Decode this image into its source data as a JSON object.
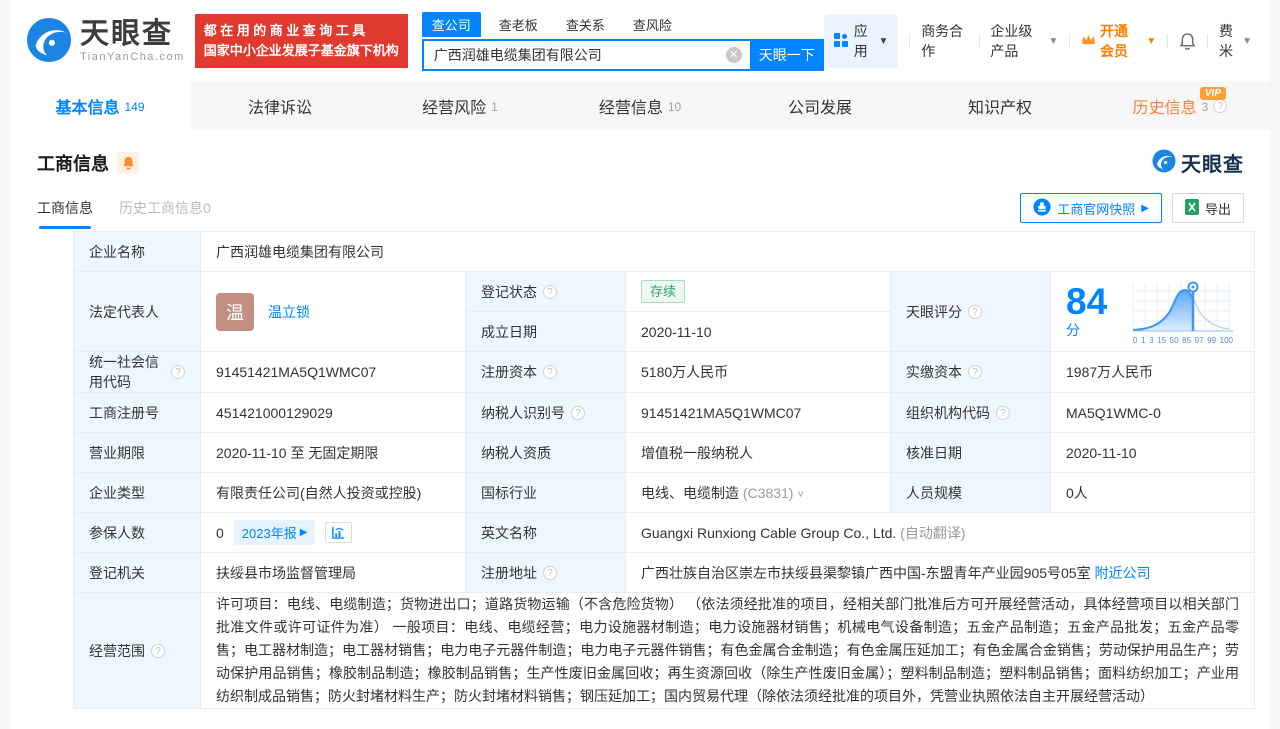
{
  "colors": {
    "primary_blue": "#0084ff",
    "vip_orange": "#ff7d00",
    "promo_red": "#e03a2f",
    "status_green": "#2aa85f",
    "label_cell_blue": "#eef7ff",
    "avatar_brown": "#c28f82"
  },
  "header": {
    "brand": "天眼查",
    "brand_domain": "TianYanCha.com",
    "promo_line1": "都在用的商业查询工具",
    "promo_line2": "国家中小企业发展子基金旗下机构",
    "search_tabs": [
      {
        "label": "查公司"
      },
      {
        "label": "查老板"
      },
      {
        "label": "查关系"
      },
      {
        "label": "查风险"
      }
    ],
    "search_value": "广西润雄电缆集团有限公司",
    "search_button": "天眼一下",
    "nav_apps": "应用",
    "nav_cooperation": "商务合作",
    "nav_enterprise": "企业级产品",
    "nav_vip": "开通会员",
    "nav_user": "费米"
  },
  "tabs": [
    {
      "label": "基本信息",
      "count": "149"
    },
    {
      "label": "法律诉讼",
      "count": ""
    },
    {
      "label": "经营风险",
      "count": "1"
    },
    {
      "label": "经营信息",
      "count": "10"
    },
    {
      "label": "公司发展",
      "count": ""
    },
    {
      "label": "知识产权",
      "count": ""
    },
    {
      "label": "历史信息",
      "count": "3",
      "badge": "VIP"
    }
  ],
  "section": {
    "title": "工商信息",
    "subtab_active": "工商信息",
    "subtab_history": "历史工商信息0",
    "snapshot_button": "工商官网快照",
    "export_button": "导出",
    "watermark": "天眼查"
  },
  "table": {
    "company_name_label": "企业名称",
    "company_name": "广西润雄电缆集团有限公司",
    "legal_rep_label": "法定代表人",
    "legal_rep_avatar": "温",
    "legal_rep_name": "温立锁",
    "reg_status_label": "登记状态",
    "reg_status": "存续",
    "establish_label": "成立日期",
    "establish_date": "2020-11-10",
    "score_label": "天眼评分",
    "score": "84",
    "score_unit": "分",
    "score_ticks": [
      "0",
      "1",
      "3",
      "15",
      "50",
      "85",
      "97",
      "99",
      "100"
    ],
    "uscc_label": "统一社会信用代码",
    "uscc": "91451421MA5Q1WMC07",
    "reg_capital_label": "注册资本",
    "reg_capital": "5180万人民币",
    "paid_capital_label": "实缴资本",
    "paid_capital": "1987万人民币",
    "reg_number_label": "工商注册号",
    "reg_number": "451421000129029",
    "taxpayer_id_label": "纳税人识别号",
    "taxpayer_id": "91451421MA5Q1WMC07",
    "org_code_label": "组织机构代码",
    "org_code": "MA5Q1WMC-0",
    "business_term_label": "营业期限",
    "business_term": "2020-11-10 至 无固定期限",
    "taxpayer_quality_label": "纳税人资质",
    "taxpayer_quality": "增值税一般纳税人",
    "approval_date_label": "核准日期",
    "approval_date": "2020-11-10",
    "company_type_label": "企业类型",
    "company_type": "有限责任公司(自然人投资或控股)",
    "industry_label": "国标行业",
    "industry": "电线、电缆制造",
    "industry_code": "(C3831)",
    "staff_size_label": "人员规模",
    "staff_size": "0人",
    "insured_label": "参保人数",
    "insured_count": "0",
    "annual_report": "2023年报",
    "english_name_label": "英文名称",
    "english_name": "Guangxi Runxiong Cable Group Co., Ltd.",
    "english_name_note": "(自动翻译)",
    "reg_authority_label": "登记机关",
    "reg_authority": "扶绥县市场监督管理局",
    "address_label": "注册地址",
    "address": "广西壮族自治区崇左市扶绥县渠黎镇广西中国-东盟青年产业园905号05室",
    "nearby_link": "附近公司",
    "business_scope_label": "经营范围",
    "business_scope": "许可项目：电线、电缆制造；货物进出口；道路货物运输（不含危险货物） （依法须经批准的项目，经相关部门批准后方可开展经营活动，具体经营项目以相关部门批准文件或许可证件为准） 一般项目：电线、电缆经营；电力设施器材制造；电力设施器材销售；机械电气设备制造；五金产品制造；五金产品批发；五金产品零售；电工器材制造；电工器材销售；电力电子元器件制造；电力电子元器件销售；有色金属合金制造；有色金属压延加工；有色金属合金销售；劳动保护用品生产；劳动保护用品销售；橡胶制品制造；橡胶制品销售；生产性废旧金属回收；再生资源回收（除生产性废旧金属）；塑料制品制造；塑料制品销售；面料纺织加工；产业用纺织制成品销售；防火封堵材料生产；防火封堵材料销售；钢压延加工；国内贸易代理（除依法须经批准的项目外，凭营业执照依法自主开展经营活动）"
  }
}
